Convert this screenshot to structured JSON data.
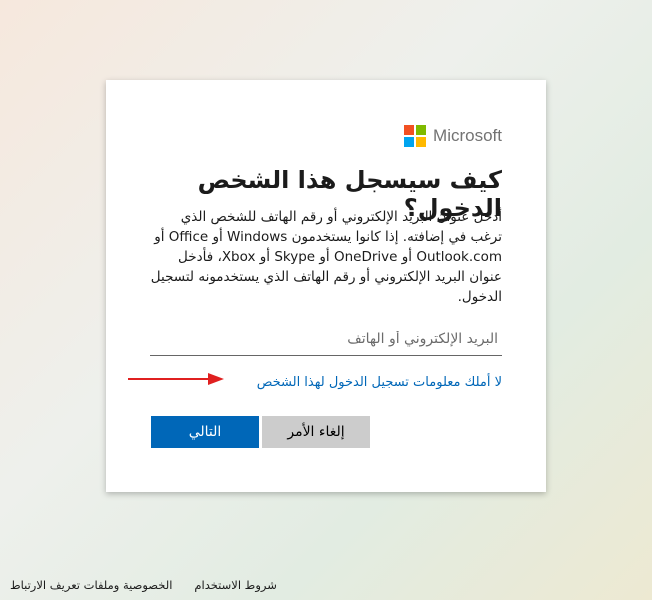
{
  "brand": {
    "name": "Microsoft",
    "colors": [
      "#f25022",
      "#7fba00",
      "#00a4ef",
      "#ffb900"
    ]
  },
  "dialog": {
    "title": "كيف سيسجل هذا الشخص الدخول؟",
    "description": "أدخل عنوان البريد الإلكتروني أو رقم الهاتف للشخص الذي ترغب في إضافته. إذا كانوا يستخدمون Windows أو Office أو Outlook.com أو OneDrive أو Skype أو Xbox، فأدخل عنوان البريد الإلكتروني أو رقم الهاتف الذي يستخدمونه لتسجيل الدخول.",
    "input": {
      "placeholder": "البريد الإلكتروني أو الهاتف",
      "value": ""
    },
    "no_info_link": "لا أملك معلومات تسجيل الدخول لهذا الشخص",
    "cancel_label": "إلغاء الأمر",
    "next_label": "التالي"
  },
  "annotation": {
    "arrow_color": "#e02020"
  },
  "footer": {
    "terms": "شروط الاستخدام",
    "privacy": "الخصوصية وملفات تعريف الارتباط"
  }
}
